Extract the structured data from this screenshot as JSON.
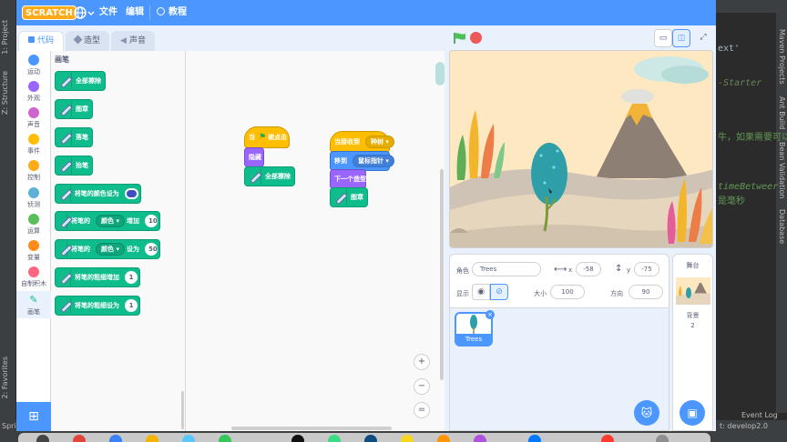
{
  "ide": {
    "left_tabs": [
      "1: Project",
      "Z: Structure",
      "2: Favorites"
    ],
    "right_tabs": [
      "Maven Projects",
      "Ant Build",
      "Bean Validation",
      "Database"
    ],
    "code": {
      "line1": "ext'",
      "line2": "-Starter",
      "line3": "牛，如果需要可以",
      "line4": "timeBetweer",
      "line5": "是毫秒"
    },
    "status_right": "Event Log",
    "status_branch": "t: develop2.0",
    "status_left": "Spri"
  },
  "menubar": {
    "logo": "SCRATCH",
    "file": "文件",
    "edit": "编辑",
    "tutorials": "教程"
  },
  "tabs": {
    "code": "代码",
    "costumes": "造型",
    "sounds": "声音"
  },
  "categories": [
    {
      "label": "运动",
      "color": "#4c97ff"
    },
    {
      "label": "外观",
      "color": "#9966ff"
    },
    {
      "label": "声音",
      "color": "#cf63cf"
    },
    {
      "label": "事件",
      "color": "#ffbf00"
    },
    {
      "label": "控制",
      "color": "#ffab19"
    },
    {
      "label": "侦测",
      "color": "#5cb1d6"
    },
    {
      "label": "运算",
      "color": "#59c059"
    },
    {
      "label": "变量",
      "color": "#ff8c1a"
    },
    {
      "label": "自制积木",
      "color": "#ff6680"
    },
    {
      "label": "画笔",
      "color": "#0fbd8c"
    }
  ],
  "palette": {
    "title": "画笔",
    "clear": "全部擦除",
    "stamp": "图章",
    "pen_down": "落笔",
    "pen_up": "抬笔",
    "set_color_to": "将笔的颜色设为",
    "change_pen": "将笔的",
    "color_option": "颜色",
    "change_by": "增加",
    "change_value": "10",
    "set_to": "设为",
    "set_value": "50",
    "change_size": "将笔的粗细增加",
    "change_size_value": "1",
    "set_size": "将笔的粗细设为",
    "set_size_value": "1"
  },
  "scripts": {
    "when_flag": "当",
    "clicked": "被点击",
    "hide": "隐藏",
    "clear_all": "全部擦除",
    "when_receive": "当接收到",
    "message": "种树",
    "go_to": "移到",
    "target": "鼠标指针",
    "next_costume": "下一个造型",
    "stamp": "图章"
  },
  "zoom": {
    "in": "+",
    "out": "−",
    "reset": "="
  },
  "sprite_info": {
    "sprite_label": "角色",
    "sprite_name": "Trees",
    "x_label": "x",
    "x_value": "-58",
    "y_label": "y",
    "y_value": "-75",
    "show_label": "显示",
    "size_label": "大小",
    "size_value": "100",
    "direction_label": "方向",
    "direction_value": "90"
  },
  "sprite_card": {
    "name": "Trees"
  },
  "stage_pane": {
    "title": "舞台",
    "backdrops_label": "背景",
    "backdrops_count": "2"
  },
  "colors": {
    "menubar": "#4c97ff",
    "pen": "#0fbd8c",
    "events": "#ffbf00",
    "looks": "#9966ff",
    "motion": "#4c97ff"
  }
}
